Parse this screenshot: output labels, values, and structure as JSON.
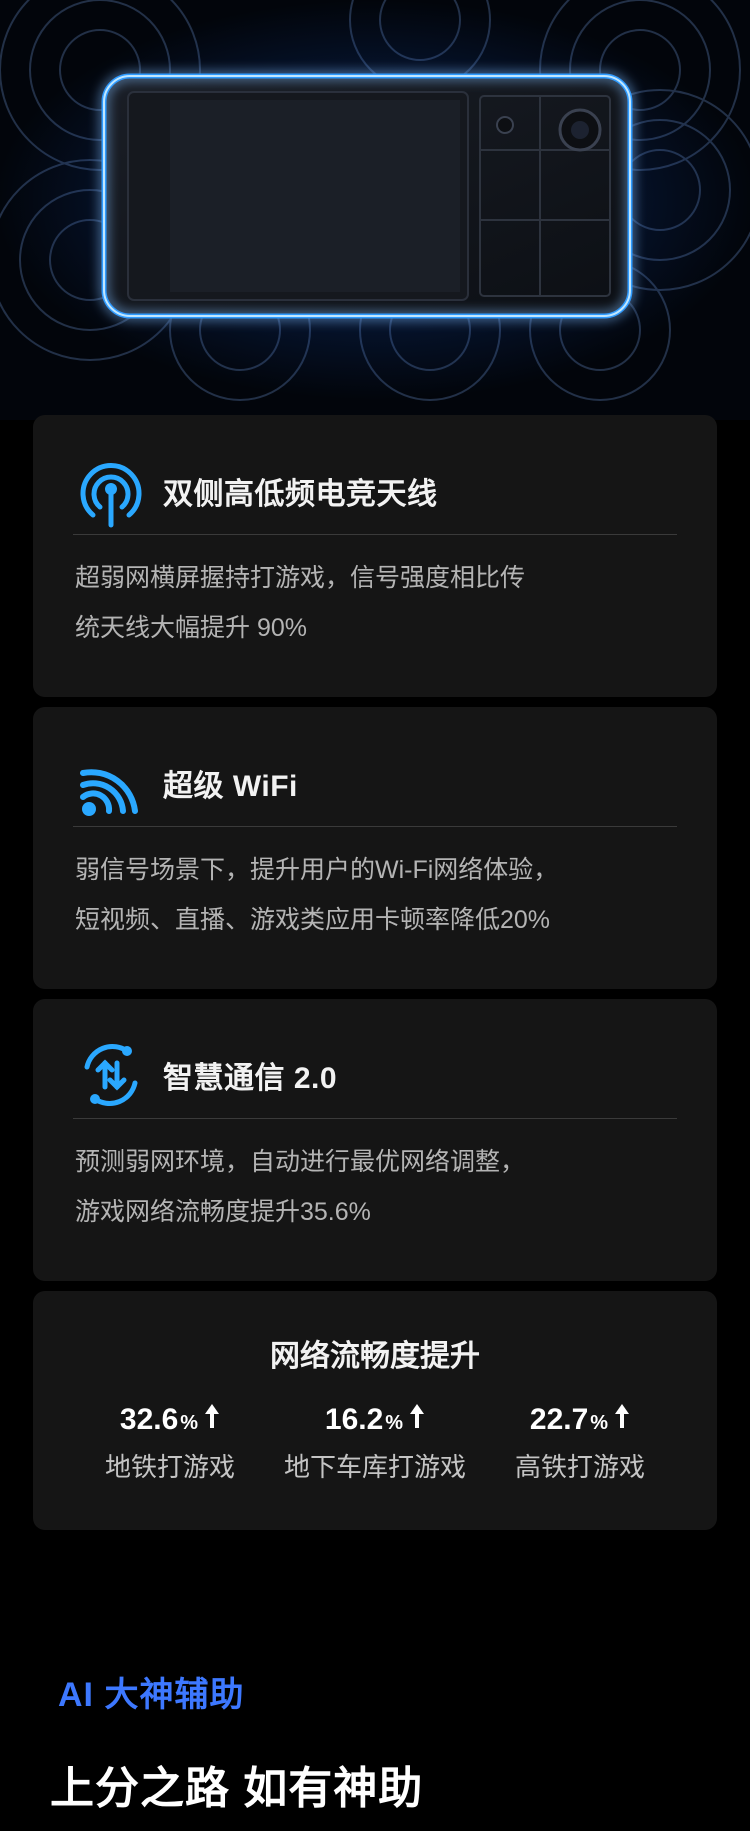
{
  "features": [
    {
      "icon": "antenna-signal-icon",
      "title": "双侧高低频电竞天线",
      "desc_line1": "超弱网横屏握持打游戏，信号强度相比传",
      "desc_line2": "统天线大幅提升 90%"
    },
    {
      "icon": "wifi-icon",
      "title": "超级 WiFi",
      "desc_line1": "弱信号场景下，提升用户的Wi-Fi网络体验，",
      "desc_line2": "短视频、直播、游戏类应用卡顿率降低20%"
    },
    {
      "icon": "sync-arrows-icon",
      "title": "智慧通信 2.0",
      "desc_line1": "预测弱网环境，自动进行最优网络调整，",
      "desc_line2": "游戏网络流畅度提升35.6%"
    }
  ],
  "stats": {
    "title": "网络流畅度提升",
    "items": [
      {
        "value": "32.6",
        "unit": "%",
        "label": "地铁打游戏"
      },
      {
        "value": "16.2",
        "unit": "%",
        "label": "地下车库打游戏"
      },
      {
        "value": "22.7",
        "unit": "%",
        "label": "高铁打游戏"
      }
    ]
  },
  "section": {
    "tag": "AI 大神辅助",
    "title": "上分之路 如有神助"
  },
  "colors": {
    "background": "#000000",
    "card": "#151515",
    "accent_blue": "#2aa8ff",
    "tag_blue": "#3d78ff"
  }
}
